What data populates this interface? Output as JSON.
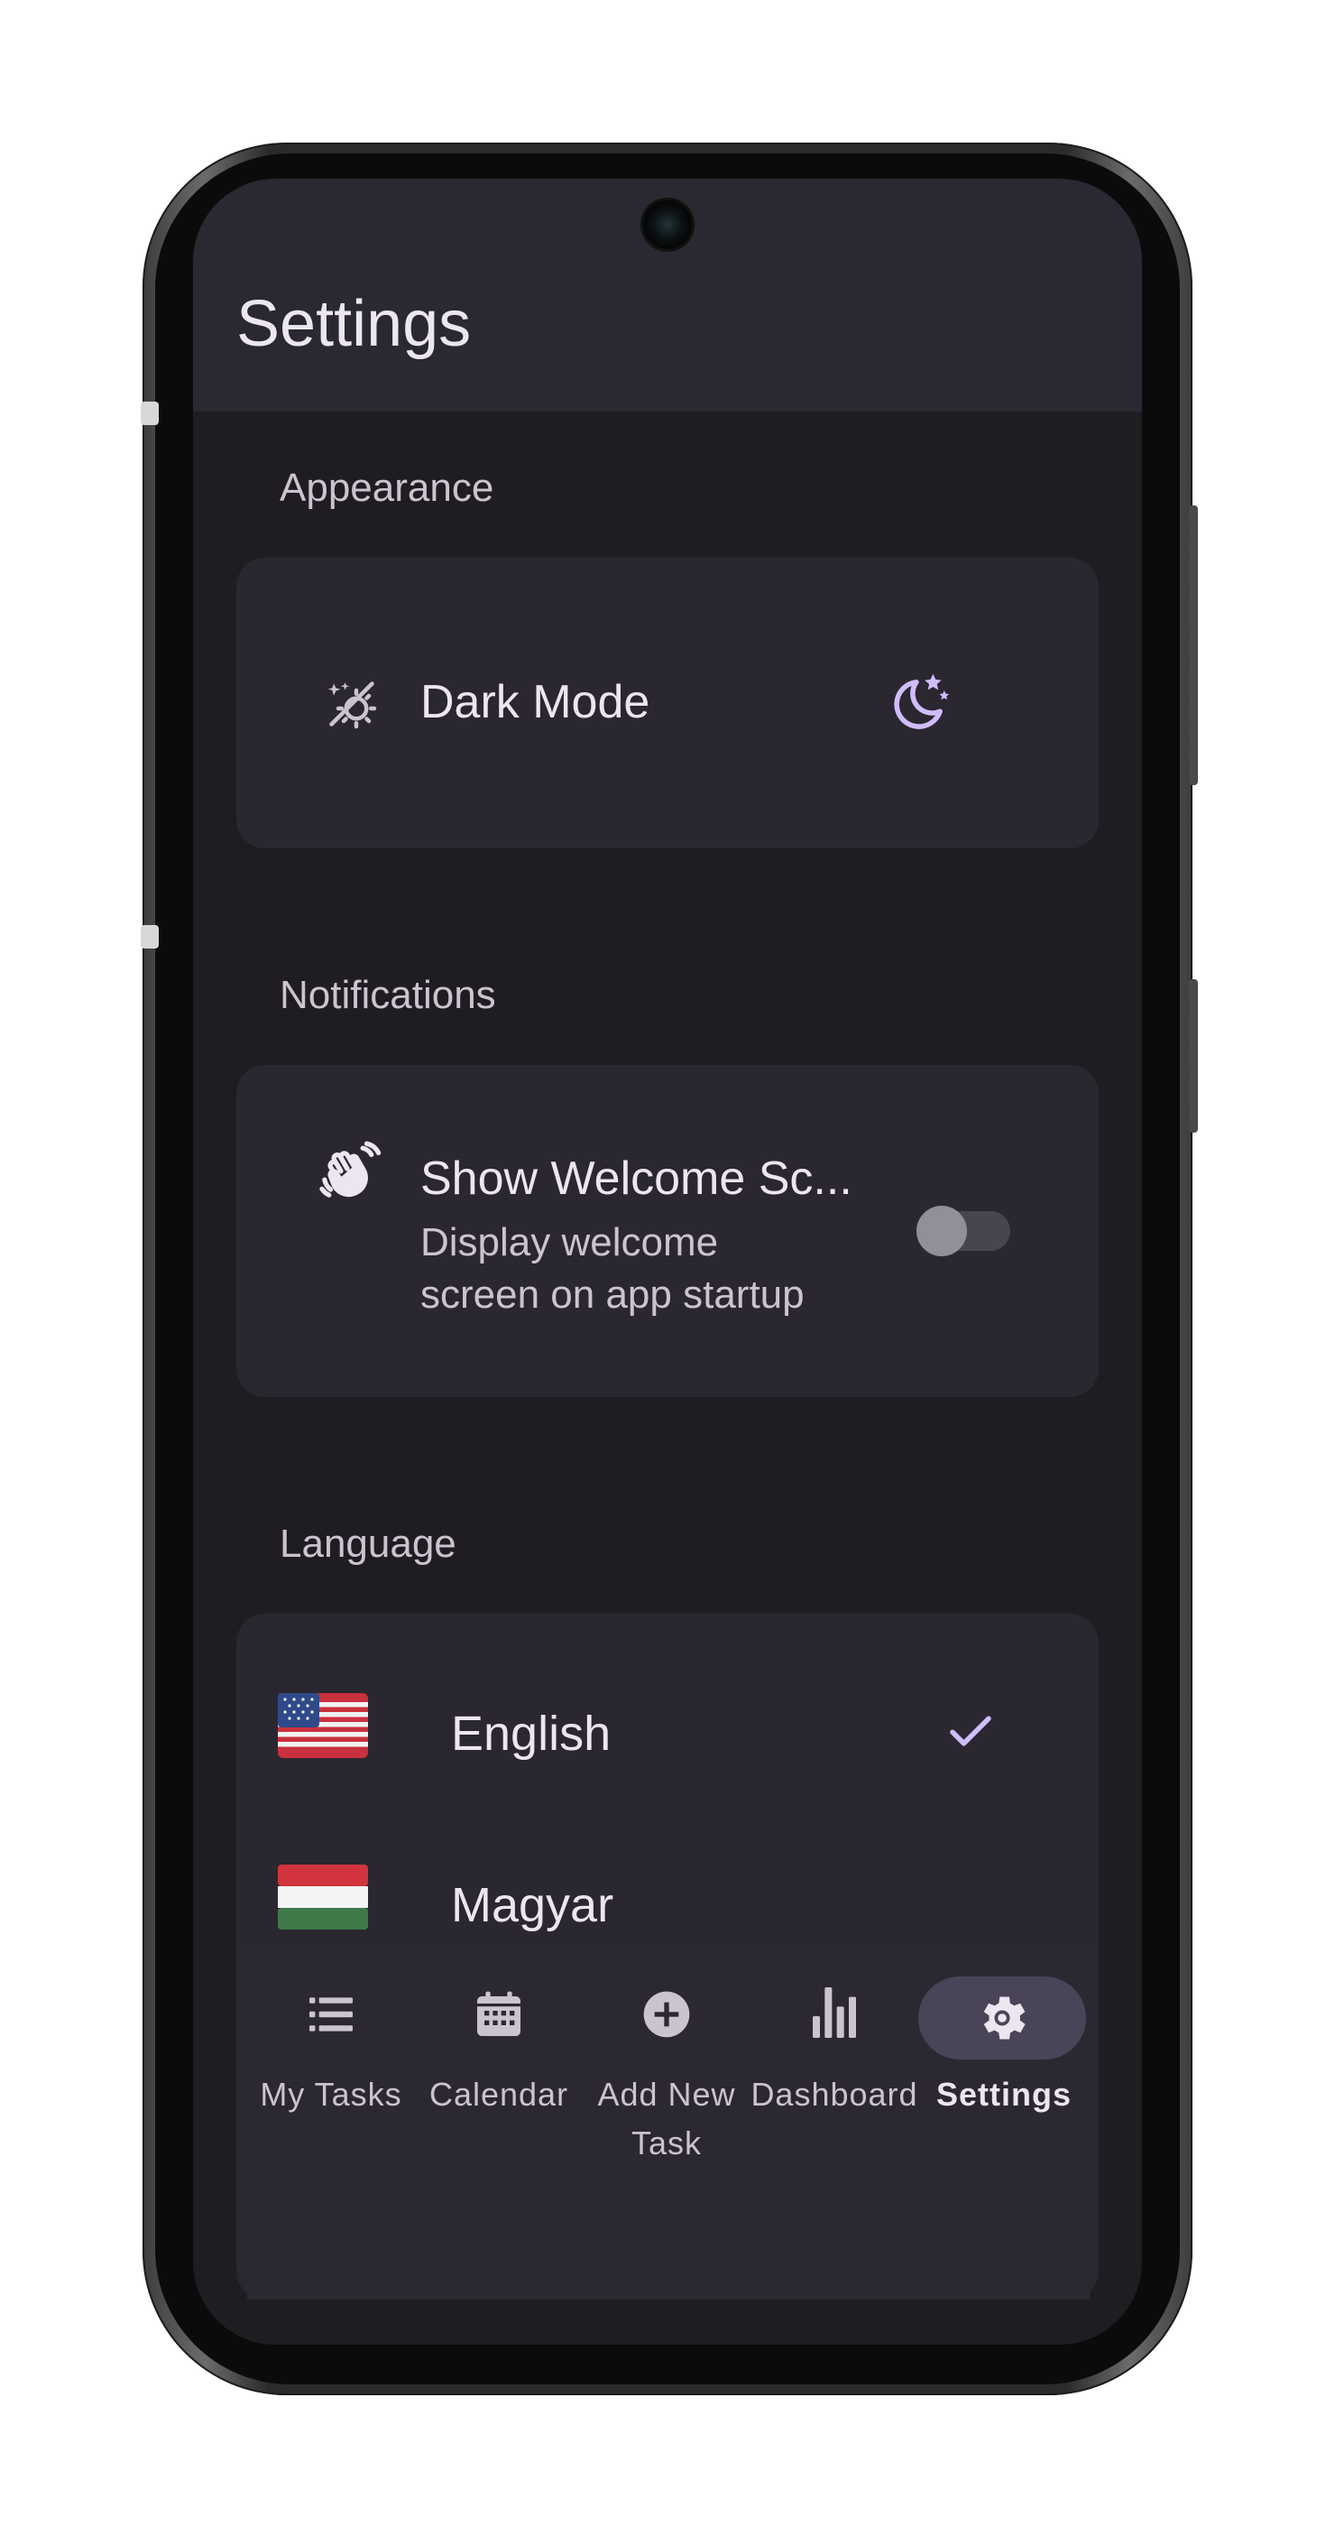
{
  "app": {
    "title": "Settings"
  },
  "sections": {
    "appearance": {
      "label": "Appearance",
      "dark_mode": {
        "title": "Dark Mode",
        "icon": "theme-auto-icon",
        "state_icon": "moon-stars-icon"
      }
    },
    "notifications": {
      "label": "Notifications",
      "welcome": {
        "title": "Show Welcome Sc...",
        "subtitle_line1": "Display welcome",
        "subtitle_line2": "screen on app startup",
        "icon": "waving-hand-icon",
        "enabled": false
      }
    },
    "language": {
      "label": "Language",
      "items": [
        {
          "name": "English",
          "flag": "🇺🇸",
          "selected": true
        },
        {
          "name": "Magyar",
          "flag": "🇭🇺",
          "selected": false
        }
      ]
    }
  },
  "nav": {
    "items": [
      {
        "label": "My Tasks",
        "icon": "list-icon",
        "active": false
      },
      {
        "label": "Calendar",
        "icon": "calendar-icon",
        "active": false
      },
      {
        "label_line1": "Add New",
        "label_line2": "Task",
        "icon": "add-circle-icon",
        "active": false
      },
      {
        "label": "Dashboard",
        "icon": "bar-chart-icon",
        "active": false
      },
      {
        "label": "Settings",
        "icon": "gear-icon",
        "active": true
      }
    ]
  },
  "colors": {
    "background": "#1f1d22",
    "surface": "#2a2730",
    "accent": "#d0bcff",
    "active_pill": "#4a4458"
  }
}
